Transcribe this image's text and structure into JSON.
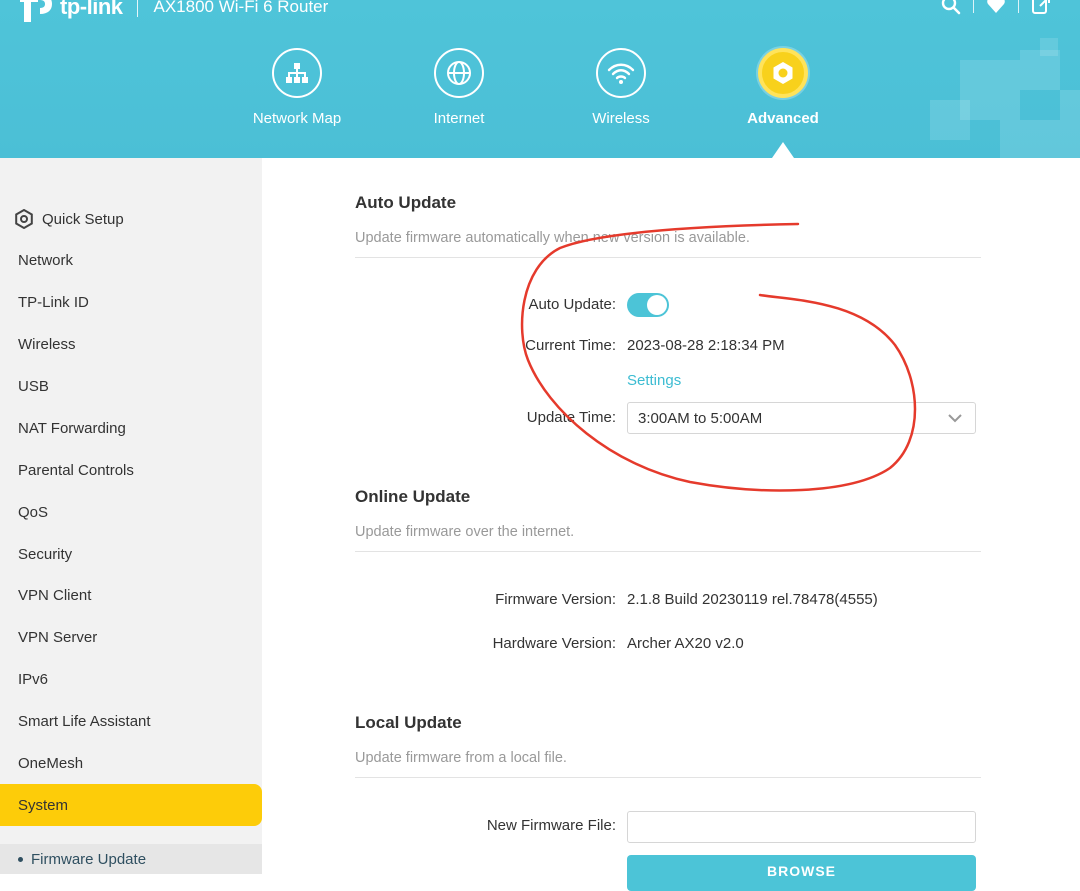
{
  "brand": {
    "logo_text": "tp-link",
    "model": "AX1800 Wi-Fi 6 Router"
  },
  "top_icons": [
    "search-icon",
    "heart-icon",
    "logout-icon"
  ],
  "nav": [
    {
      "label": "Network Map",
      "icon": "network-map-icon",
      "active": false
    },
    {
      "label": "Internet",
      "icon": "globe-icon",
      "active": false
    },
    {
      "label": "Wireless",
      "icon": "wifi-icon",
      "active": false
    },
    {
      "label": "Advanced",
      "icon": "gear-icon",
      "active": true
    }
  ],
  "sidebar": {
    "items": [
      {
        "label": "Quick Setup",
        "icon": "gear-icon"
      },
      {
        "label": "Network"
      },
      {
        "label": "TP-Link ID"
      },
      {
        "label": "Wireless"
      },
      {
        "label": "USB"
      },
      {
        "label": "NAT Forwarding"
      },
      {
        "label": "Parental Controls"
      },
      {
        "label": "QoS"
      },
      {
        "label": "Security"
      },
      {
        "label": "VPN Client"
      },
      {
        "label": "VPN Server"
      },
      {
        "label": "IPv6"
      },
      {
        "label": "Smart Life Assistant"
      },
      {
        "label": "OneMesh"
      },
      {
        "label": "System",
        "active": true
      }
    ],
    "sub_item": "Firmware Update"
  },
  "auto_update": {
    "title": "Auto Update",
    "desc": "Update firmware automatically when new version is available.",
    "toggle_label": "Auto Update:",
    "toggle_on": true,
    "current_time_label": "Current Time:",
    "current_time": "2023-08-28 2:18:34 PM",
    "settings_link": "Settings",
    "update_time_label": "Update Time:",
    "update_time": "3:00AM to 5:00AM"
  },
  "online_update": {
    "title": "Online Update",
    "desc": "Update firmware over the internet.",
    "firmware_label": "Firmware Version:",
    "firmware_value": "2.1.8 Build 20230119 rel.78478(4555)",
    "hardware_label": "Hardware Version:",
    "hardware_value": "Archer AX20 v2.0"
  },
  "local_update": {
    "title": "Local Update",
    "desc": "Update firmware from a local file.",
    "file_label": "New Firmware File:",
    "file_value": "",
    "browse_label": "BROWSE"
  },
  "colors": {
    "header": "#4bc1d7",
    "accent": "#4cc4d7",
    "active_nav": "#f8d11c",
    "sidebar_active": "#fdcc09",
    "annotation": "#e53a2c"
  }
}
